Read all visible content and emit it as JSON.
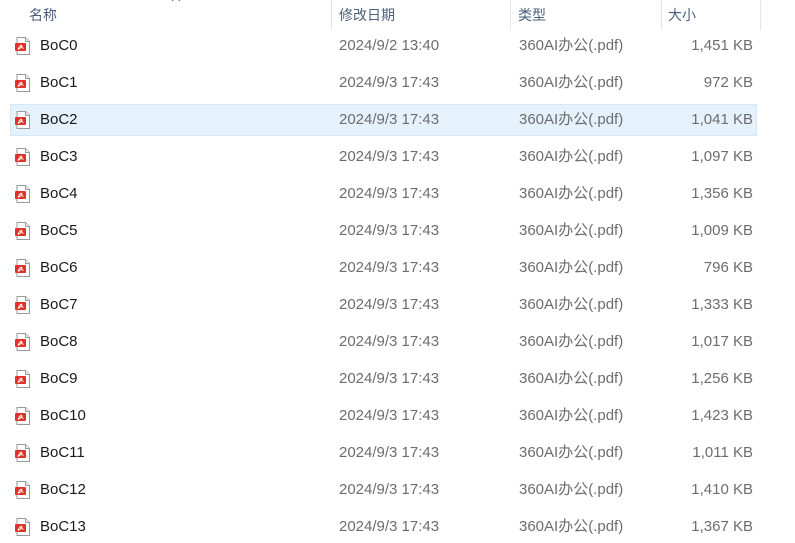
{
  "columns": {
    "name": "名称",
    "modified": "修改日期",
    "type": "类型",
    "size": "大小"
  },
  "icons": {
    "file": "pdf-file-icon",
    "sort": "sort-up-icon"
  },
  "colors": {
    "selected_bg": "#e5f1fb",
    "header_text": "#4c607a",
    "pdf_red": "#e0322a"
  },
  "selected_index": 2,
  "files": [
    {
      "name": "BoC0",
      "modified": "2024/9/2 13:40",
      "type": "360AI办公(.pdf)",
      "size": "1,451 KB"
    },
    {
      "name": "BoC1",
      "modified": "2024/9/3 17:43",
      "type": "360AI办公(.pdf)",
      "size": "972 KB"
    },
    {
      "name": "BoC2",
      "modified": "2024/9/3 17:43",
      "type": "360AI办公(.pdf)",
      "size": "1,041 KB"
    },
    {
      "name": "BoC3",
      "modified": "2024/9/3 17:43",
      "type": "360AI办公(.pdf)",
      "size": "1,097 KB"
    },
    {
      "name": "BoC4",
      "modified": "2024/9/3 17:43",
      "type": "360AI办公(.pdf)",
      "size": "1,356 KB"
    },
    {
      "name": "BoC5",
      "modified": "2024/9/3 17:43",
      "type": "360AI办公(.pdf)",
      "size": "1,009 KB"
    },
    {
      "name": "BoC6",
      "modified": "2024/9/3 17:43",
      "type": "360AI办公(.pdf)",
      "size": "796 KB"
    },
    {
      "name": "BoC7",
      "modified": "2024/9/3 17:43",
      "type": "360AI办公(.pdf)",
      "size": "1,333 KB"
    },
    {
      "name": "BoC8",
      "modified": "2024/9/3 17:43",
      "type": "360AI办公(.pdf)",
      "size": "1,017 KB"
    },
    {
      "name": "BoC9",
      "modified": "2024/9/3 17:43",
      "type": "360AI办公(.pdf)",
      "size": "1,256 KB"
    },
    {
      "name": "BoC10",
      "modified": "2024/9/3 17:43",
      "type": "360AI办公(.pdf)",
      "size": "1,423 KB"
    },
    {
      "name": "BoC11",
      "modified": "2024/9/3 17:43",
      "type": "360AI办公(.pdf)",
      "size": "1,011 KB"
    },
    {
      "name": "BoC12",
      "modified": "2024/9/3 17:43",
      "type": "360AI办公(.pdf)",
      "size": "1,410 KB"
    },
    {
      "name": "BoC13",
      "modified": "2024/9/3 17:43",
      "type": "360AI办公(.pdf)",
      "size": "1,367 KB"
    }
  ]
}
